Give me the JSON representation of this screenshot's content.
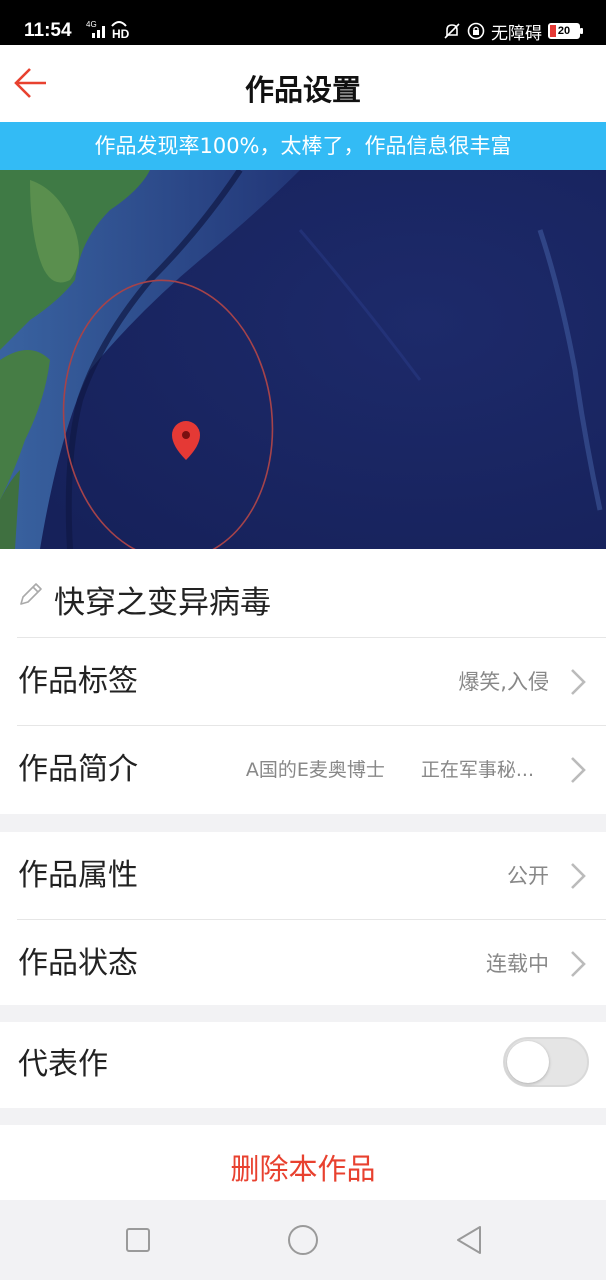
{
  "status_bar": {
    "time": "11:54",
    "network": "4G",
    "hd": "HD",
    "accessibility": "无障碍",
    "battery": "20",
    "icons": [
      "signal-icon",
      "mute-icon",
      "lock-rotation-icon",
      "battery-icon"
    ]
  },
  "header": {
    "title": "作品设置",
    "back_icon": "back-arrow-icon"
  },
  "banner": {
    "text": "作品发现率100%，太棒了，作品信息很丰富"
  },
  "work": {
    "title": "快穿之变异病毒",
    "edit_icon": "pencil-icon"
  },
  "rows": {
    "tags": {
      "label": "作品标签",
      "value": "爆笑,入侵"
    },
    "intro": {
      "label": "作品简介",
      "value_part1": "A国的E麦奥博士",
      "value_part2": "正在军事秘..."
    },
    "attribute": {
      "label": "作品属性",
      "value": "公开"
    },
    "status": {
      "label": "作品状态",
      "value": "连载中"
    },
    "representative": {
      "label": "代表作",
      "enabled": false
    }
  },
  "actions": {
    "delete": "删除本作品"
  },
  "colors": {
    "accent": "#e8412f",
    "banner": "#33bbf5",
    "marker": "#e53935"
  }
}
